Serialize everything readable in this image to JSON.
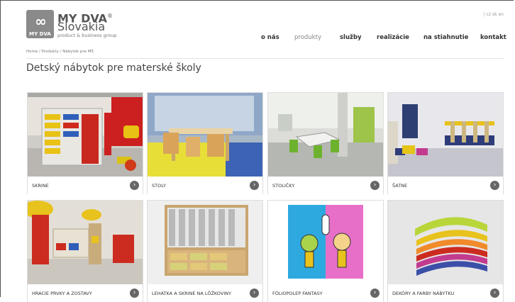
{
  "header": {
    "logo_mark_text": "MY DVA",
    "brand_line1": "MY DVA",
    "brand_reg": "®",
    "brand_line2": "Slovakia",
    "brand_tagline": "product & business group",
    "languages": "| cz sk en"
  },
  "nav": {
    "items": [
      {
        "label": "o nás"
      },
      {
        "label": "produkty"
      },
      {
        "label": "služby"
      },
      {
        "label": "realizácie"
      },
      {
        "label": "na stiahnutie"
      },
      {
        "label": "kontakt"
      }
    ]
  },
  "breadcrumb": "Home / Produkty / Nábytok pre MŠ",
  "page_title": "Detský nábytok pre materské školy",
  "products": [
    {
      "label": "SKRINE"
    },
    {
      "label": "STOLY"
    },
    {
      "label": "STOLIČKY"
    },
    {
      "label": "ŠATNE"
    },
    {
      "label": "HRACIE PRVKY A ZOSTAVY"
    },
    {
      "label": "LEHÁTKA A SKRINE NA LÔŽKOVINY"
    },
    {
      "label": "FÓLIOPOLEP FANTASY"
    },
    {
      "label": "DEKÓRY A FARBY NÁBYTKU"
    }
  ],
  "arrow_glyph": "›"
}
